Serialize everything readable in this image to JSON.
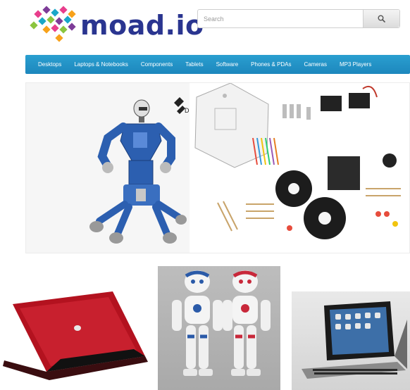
{
  "header": {
    "logo_text": "moad.io",
    "logo_colors": [
      "#e83e8c",
      "#f7a21b",
      "#1aa7c8",
      "#8bc53f",
      "#7d3c98"
    ],
    "brand_color": "#2a3590"
  },
  "search": {
    "placeholder": "Search",
    "button_icon": "search-icon"
  },
  "nav": {
    "background": "#2196c9",
    "items": [
      {
        "label": "Desktops"
      },
      {
        "label": "Laptops & Notebooks"
      },
      {
        "label": "Components"
      },
      {
        "label": "Tablets"
      },
      {
        "label": "Software"
      },
      {
        "label": "Phones & PDAs"
      },
      {
        "label": "Cameras"
      },
      {
        "label": "MP3 Players"
      }
    ]
  },
  "banner": {
    "left_image": "humanoid-robot-image",
    "right_image": "robot-parts-kit-image"
  },
  "products": [
    {
      "image": "red-laptop-image"
    },
    {
      "image": "nao-robots-image"
    },
    {
      "image": "ipad-keyboard-case-image"
    }
  ]
}
